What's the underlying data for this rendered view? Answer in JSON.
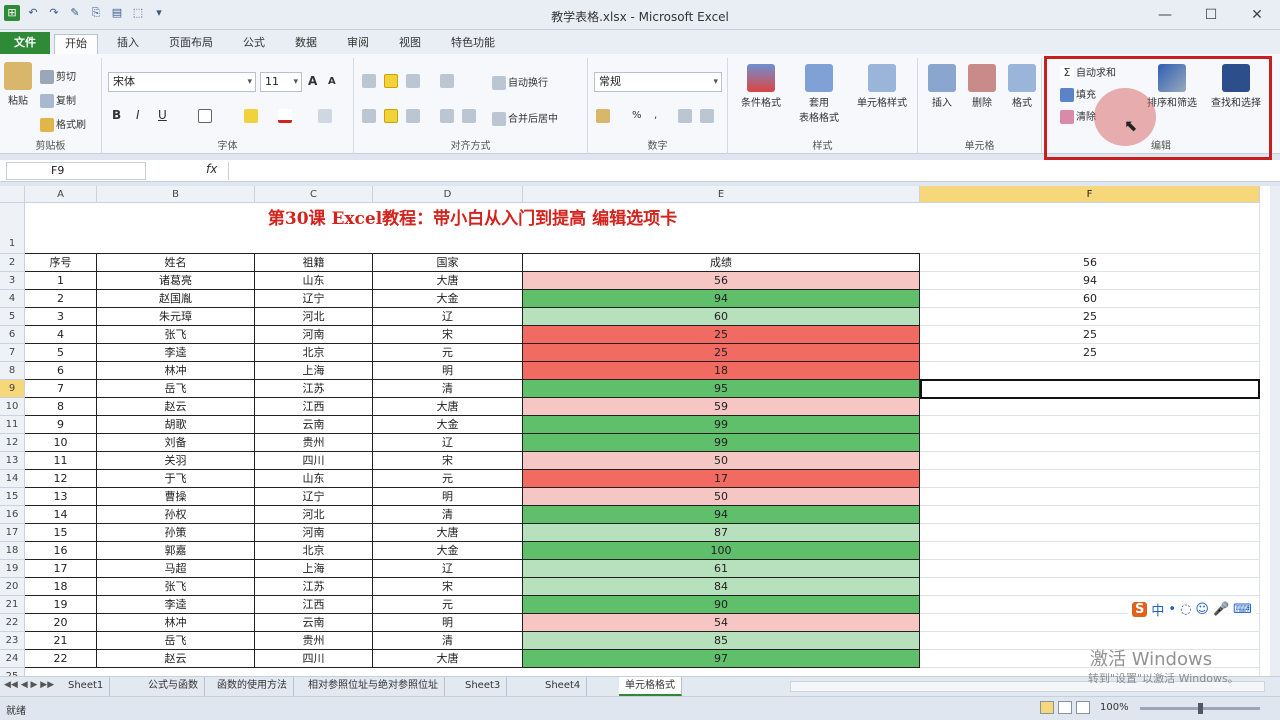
{
  "window": {
    "title": "教学表格.xlsx - Microsoft Excel",
    "min": "—",
    "max": "☐",
    "close": "✕"
  },
  "qat": [
    "⊞",
    "↶",
    "↷",
    "✎",
    "⎘",
    "▤",
    "⬚",
    "▾"
  ],
  "tabs": [
    "文件",
    "开始",
    "插入",
    "页面布局",
    "公式",
    "数据",
    "审阅",
    "视图",
    "特色功能"
  ],
  "help_icons": [
    "♢",
    "?",
    "▭",
    "⬚",
    "✕"
  ],
  "ribbon": {
    "clipboard": {
      "paste": "粘贴",
      "cut": "剪切",
      "copy": "复制",
      "format_painter": "格式刷",
      "label": "剪贴板"
    },
    "font": {
      "name": "宋体",
      "size": "11",
      "grow": "A",
      "shrink": "A",
      "bold": "B",
      "italic": "I",
      "underline": "U",
      "label": "字体"
    },
    "align": {
      "wrap": "自动换行",
      "merge": "合并后居中",
      "label": "对齐方式"
    },
    "number": {
      "format": "常规",
      "percent": "%",
      "comma": ",",
      "label": "数字"
    },
    "styles": {
      "cond": "条件格式",
      "table": "套用\n表格格式",
      "cell": "单元格样式",
      "label": "样式"
    },
    "cells": {
      "insert": "插入",
      "delete": "删除",
      "format": "格式",
      "label": "单元格"
    },
    "editing": {
      "autosum": "自动求和",
      "fill": "填充",
      "clear": "清除",
      "sort": "排序和筛选",
      "find": "查找和选择",
      "label": "编辑"
    }
  },
  "formula_bar": {
    "name_box": "F9",
    "fx": "fx"
  },
  "columns": [
    "A",
    "B",
    "C",
    "D",
    "E",
    "F"
  ],
  "sheet_title": "第30课 Excel教程：带小白从入门到提高 编辑选项卡",
  "header_row": [
    "序号",
    "姓名",
    "祖籍",
    "国家",
    "成绩"
  ],
  "rows": [
    [
      "1",
      "诸葛亮",
      "山东",
      "大唐",
      "56"
    ],
    [
      "2",
      "赵国胤",
      "辽宁",
      "大金",
      "94"
    ],
    [
      "3",
      "朱元璋",
      "河北",
      "辽",
      "60"
    ],
    [
      "4",
      "张飞",
      "河南",
      "宋",
      "25"
    ],
    [
      "5",
      "李逵",
      "北京",
      "元",
      "25"
    ],
    [
      "6",
      "林冲",
      "上海",
      "明",
      "18"
    ],
    [
      "7",
      "岳飞",
      "江苏",
      "清",
      "95"
    ],
    [
      "8",
      "赵云",
      "江西",
      "大唐",
      "59"
    ],
    [
      "9",
      "胡歌",
      "云南",
      "大金",
      "99"
    ],
    [
      "10",
      "刘备",
      "贵州",
      "辽",
      "99"
    ],
    [
      "11",
      "关羽",
      "四川",
      "宋",
      "50"
    ],
    [
      "12",
      "于飞",
      "山东",
      "元",
      "17"
    ],
    [
      "13",
      "曹操",
      "辽宁",
      "明",
      "50"
    ],
    [
      "14",
      "孙权",
      "河北",
      "清",
      "94"
    ],
    [
      "15",
      "孙策",
      "河南",
      "大唐",
      "87"
    ],
    [
      "16",
      "郭嘉",
      "北京",
      "大金",
      "100"
    ],
    [
      "17",
      "马超",
      "上海",
      "辽",
      "61"
    ],
    [
      "18",
      "张飞",
      "江苏",
      "宋",
      "84"
    ],
    [
      "19",
      "李逵",
      "江西",
      "元",
      "90"
    ],
    [
      "20",
      "林冲",
      "云南",
      "明",
      "54"
    ],
    [
      "21",
      "岳飞",
      "贵州",
      "清",
      "85"
    ],
    [
      "22",
      "赵云",
      "四川",
      "大唐",
      "97"
    ]
  ],
  "f_values": [
    "56",
    "94",
    "60",
    "25",
    "25",
    "25"
  ],
  "colors": {
    "dark_red": "#f26b63",
    "light_red": "#f6c6c4",
    "dark_green": "#5fbf6b",
    "light_green": "#b7e1bd"
  },
  "sheet_tabs": [
    "Sheet1",
    "公式与函数",
    "函数的使用方法",
    "相对参照位址与绝对参照位址",
    "Sheet3",
    "Sheet4",
    "单元格格式"
  ],
  "status": {
    "ready": "就绪",
    "zoom": "100%"
  },
  "ime": [
    "S",
    "中",
    "•",
    "◌",
    "☺",
    "🎤",
    "⌨"
  ],
  "watermark": {
    "line1": "激活 Windows",
    "line2": "转到\"设置\"以激活 Windows。"
  }
}
